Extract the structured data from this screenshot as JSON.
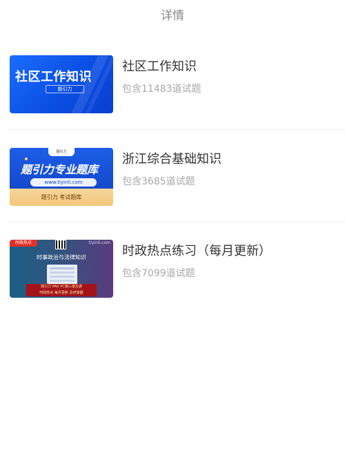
{
  "header": {
    "title": "详情"
  },
  "items": [
    {
      "title": "社区工作知识",
      "count_text": "包含11483道试题",
      "thumb": {
        "headline": "社区工作知识",
        "tag": "题引力"
      }
    },
    {
      "title": "浙江综合基础知识",
      "count_text": "包含3685道试题",
      "thumb": {
        "logo": "题引力",
        "headline": "题引力专业题库",
        "url": "www.tiyinli.com",
        "footer": "题引力 考试题库"
      }
    },
    {
      "title": "时政热点练习（每月更新）",
      "count_text": "包含7099道试题",
      "thumb": {
        "badge": "时政热点",
        "corner": "tiyinli.com",
        "headline": "时事政治与法律知识",
        "footer_line1": "题引力 PAD PC端三端互通",
        "footer_line2": "时政热点 每月更新 及时掌握"
      }
    }
  ]
}
